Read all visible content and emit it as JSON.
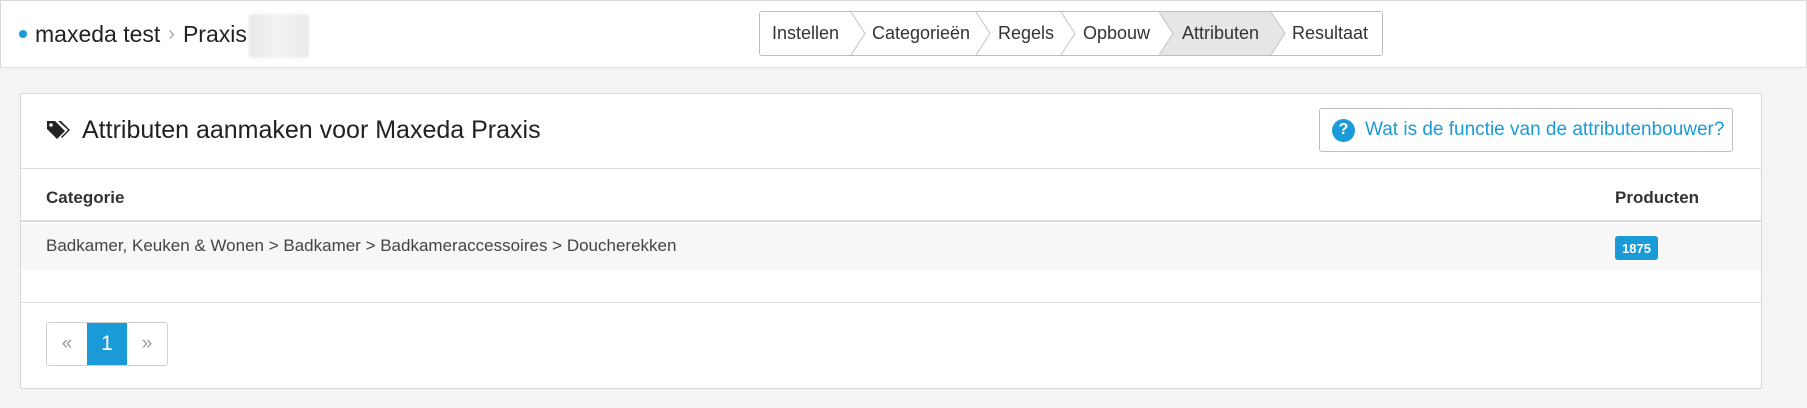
{
  "breadcrumb": {
    "project": "maxeda test",
    "client": "Praxis"
  },
  "wizard": {
    "steps": [
      {
        "label": "Instellen",
        "active": false
      },
      {
        "label": "Categorieën",
        "active": false
      },
      {
        "label": "Regels",
        "active": false
      },
      {
        "label": "Opbouw",
        "active": false
      },
      {
        "label": "Attributen",
        "active": true
      },
      {
        "label": "Resultaat",
        "active": false
      }
    ]
  },
  "panel": {
    "title": "Attributen aanmaken voor Maxeda Praxis",
    "title_icon": "tags-icon",
    "help_label": "Wat is de functie van de attributenbouwer?",
    "help_icon": "question-circle-icon"
  },
  "table": {
    "columns": {
      "category": "Categorie",
      "products": "Producten"
    },
    "rows": [
      {
        "category": "Badkamer, Keuken & Wonen > Badkamer > Badkameraccessoires > Doucherekken",
        "products": "1875"
      }
    ]
  },
  "pagination": {
    "prev": "«",
    "current": "1",
    "next": "»"
  },
  "colors": {
    "accent": "#1a9bd7",
    "active_step": "#e6e6e6"
  }
}
